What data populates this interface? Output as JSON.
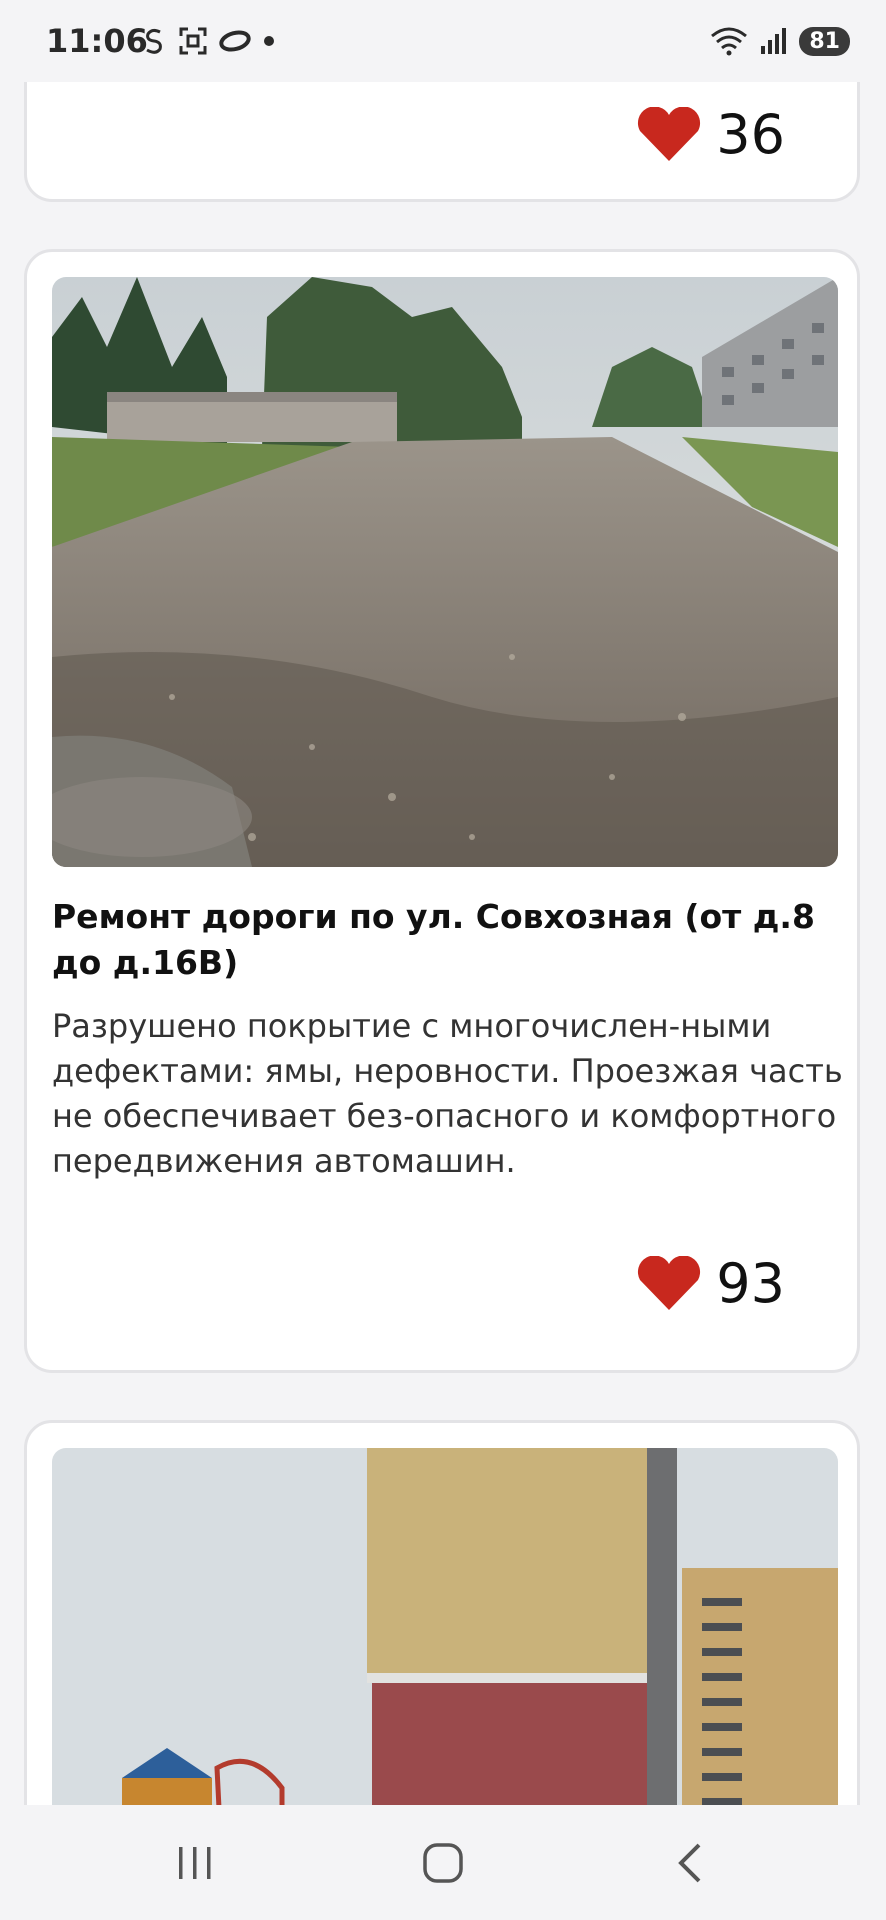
{
  "status_bar": {
    "time": "11:06",
    "battery": "81",
    "left_icons": [
      "s-circle-icon",
      "screenshot-icon",
      "oval-icon",
      "dot-icon"
    ],
    "right_icons": [
      "wifi-icon",
      "signal-icon"
    ]
  },
  "cards": [
    {
      "likes": "36"
    },
    {
      "title": "Ремонт дороги по ул. Совхозная (от д.8 до д.16В)",
      "description": "Разрушено покрытие с многочислен-ными дефектами: ямы, неровности. Проезжая часть не обеспечивает без-опасного и комфортного передвижения автомашин.",
      "likes": "93"
    },
    {}
  ],
  "colors": {
    "heart": "#c8281e",
    "card_border": "#e3e3e6",
    "background": "#f4f4f6"
  },
  "nav_bar": {
    "buttons": [
      "recent-apps",
      "home",
      "back"
    ]
  }
}
